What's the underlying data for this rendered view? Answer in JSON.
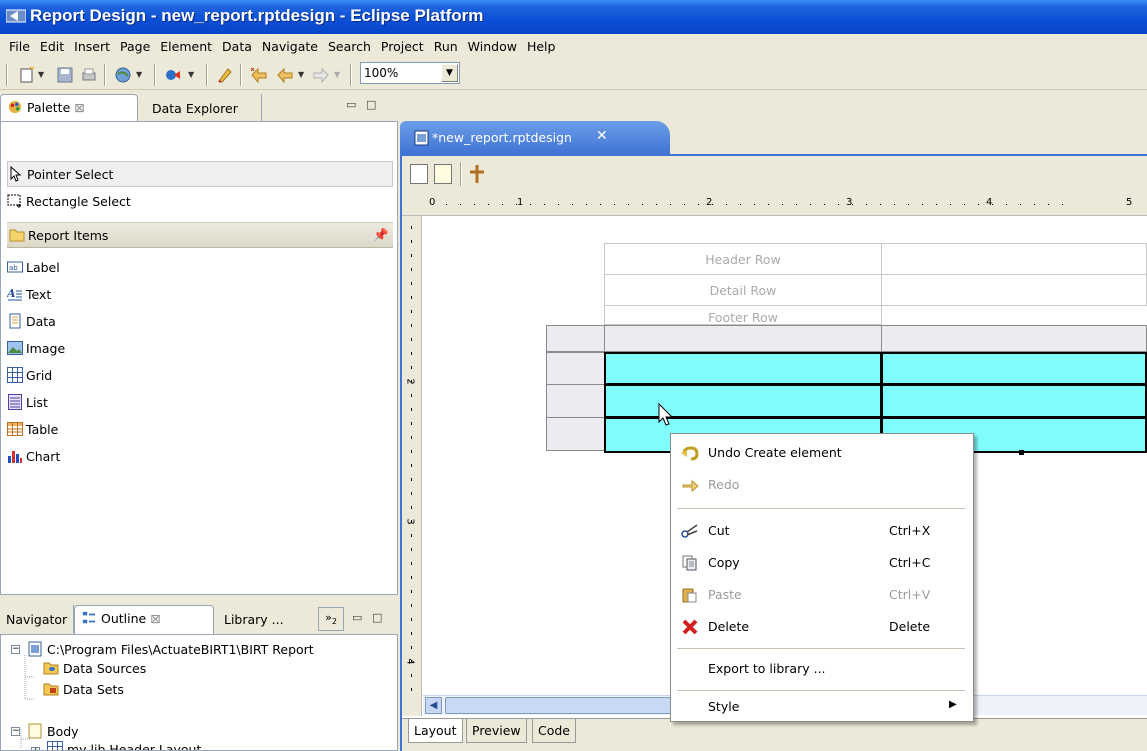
{
  "window": {
    "title": "Report Design - new_report.rptdesign - Eclipse Platform"
  },
  "menubar": [
    "File",
    "Edit",
    "Insert",
    "Page",
    "Element",
    "Data",
    "Navigate",
    "Search",
    "Project",
    "Run",
    "Window",
    "Help"
  ],
  "toolbar": {
    "zoom_value": "100%"
  },
  "palette_view": {
    "tabs": [
      {
        "label": "Palette"
      },
      {
        "label": "Data Explorer"
      }
    ],
    "tools": [
      "Pointer Select",
      "Rectangle Select"
    ],
    "drawer": "Report Items",
    "items": [
      "Label",
      "Text",
      "Data",
      "Image",
      "Grid",
      "List",
      "Table",
      "Chart"
    ]
  },
  "outline_view": {
    "tabs": [
      "Navigator",
      "Outline",
      "Library ..."
    ],
    "overflow_count": "2",
    "tree": [
      {
        "label": "C:\\Program Files\\ActuateBIRT1\\BIRT Report"
      },
      {
        "label": "Data Sources"
      },
      {
        "label": "Data Sets"
      },
      {
        "label": "Body"
      },
      {
        "label": "my lib.Header Layout"
      }
    ]
  },
  "editor": {
    "tab_title": "*new_report.rptdesign",
    "bottom_tabs": [
      "Layout",
      "Preview",
      "Code"
    ],
    "ruler_marks": [
      "0",
      "1",
      "2",
      "3",
      "4",
      "5"
    ],
    "vruler_marks": [
      "2",
      "3",
      "4"
    ],
    "table_rows": [
      "Header Row",
      "Detail Row",
      "Footer Row"
    ]
  },
  "context_menu": {
    "items": [
      {
        "label": "Undo Create element",
        "shortcut": "",
        "enabled": true
      },
      {
        "label": "Redo",
        "shortcut": "",
        "enabled": false
      },
      {
        "label": "Cut",
        "shortcut": "Ctrl+X",
        "enabled": true
      },
      {
        "label": "Copy",
        "shortcut": "Ctrl+C",
        "enabled": true
      },
      {
        "label": "Paste",
        "shortcut": "Ctrl+V",
        "enabled": false
      },
      {
        "label": "Delete",
        "shortcut": "Delete",
        "enabled": true
      },
      {
        "label": "Export to library ...",
        "shortcut": "",
        "enabled": true
      },
      {
        "label": "Style",
        "shortcut": "",
        "enabled": true
      }
    ]
  },
  "colors": {
    "title_bar": "#0a4fd6",
    "editor_tab": "#3f73d4",
    "selected_cells": "#80fcfc"
  }
}
